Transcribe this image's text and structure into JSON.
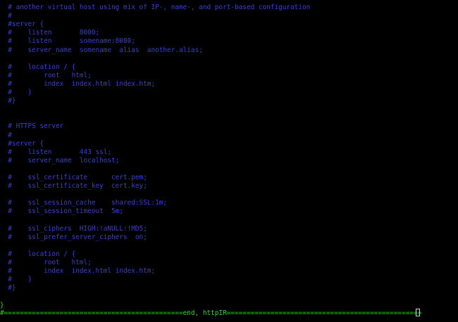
{
  "editor": {
    "lines": [
      {
        "text": "  # another virtual host using mix of IP-, name-, and port-based configuration",
        "color": "#3a3fd6"
      },
      {
        "text": "  #",
        "color": "#3a3fd6"
      },
      {
        "text": "  #server {",
        "color": "#3a3fd6"
      },
      {
        "text": "  #    listen       8000;",
        "color": "#3a3fd6"
      },
      {
        "text": "  #    listen       somename:8080;",
        "color": "#3a3fd6"
      },
      {
        "text": "  #    server_name  somename  alias  another.alias;",
        "color": "#3a3fd6"
      },
      {
        "text": "",
        "color": "#3a3fd6"
      },
      {
        "text": "  #    location / {",
        "color": "#3a3fd6"
      },
      {
        "text": "  #        root   html;",
        "color": "#3a3fd6"
      },
      {
        "text": "  #        index  index.html index.htm;",
        "color": "#3a3fd6"
      },
      {
        "text": "  #    }",
        "color": "#3a3fd6"
      },
      {
        "text": "  #}",
        "color": "#3a3fd6"
      },
      {
        "text": "",
        "color": "#3a3fd6"
      },
      {
        "text": "",
        "color": "#3a3fd6"
      },
      {
        "text": "  # HTTPS server",
        "color": "#3a3fd6"
      },
      {
        "text": "  #",
        "color": "#3a3fd6"
      },
      {
        "text": "  #server {",
        "color": "#3a3fd6"
      },
      {
        "text": "  #    listen       443 ssl;",
        "color": "#3a3fd6"
      },
      {
        "text": "  #    server_name  localhost;",
        "color": "#3a3fd6"
      },
      {
        "text": "",
        "color": "#3a3fd6"
      },
      {
        "text": "  #    ssl_certificate      cert.pem;",
        "color": "#3a3fd6"
      },
      {
        "text": "  #    ssl_certificate_key  cert.key;",
        "color": "#3a3fd6"
      },
      {
        "text": "",
        "color": "#3a3fd6"
      },
      {
        "text": "  #    ssl_session_cache    shared:SSL:1m;",
        "color": "#3a3fd6"
      },
      {
        "text": "  #    ssl_session_timeout  5m;",
        "color": "#3a3fd6"
      },
      {
        "text": "",
        "color": "#3a3fd6"
      },
      {
        "text": "  #    ssl_ciphers  HIGH:!aNULL:!MD5;",
        "color": "#3a3fd6"
      },
      {
        "text": "  #    ssl_prefer_server_ciphers  on;",
        "color": "#3a3fd6"
      },
      {
        "text": "",
        "color": "#3a3fd6"
      },
      {
        "text": "  #    location / {",
        "color": "#3a3fd6"
      },
      {
        "text": "  #        root   html;",
        "color": "#3a3fd6"
      },
      {
        "text": "  #        index  index.html index.htm;",
        "color": "#3a3fd6"
      },
      {
        "text": "  #    }",
        "color": "#3a3fd6"
      },
      {
        "text": "  #}",
        "color": "#3a3fd6"
      },
      {
        "text": "",
        "color": "#3a3fd6"
      },
      {
        "text": "}",
        "color": "#2bd52b"
      }
    ],
    "status_line": "#=============================================end, httpIR=================================================",
    "status_color": "#2bd52b"
  }
}
